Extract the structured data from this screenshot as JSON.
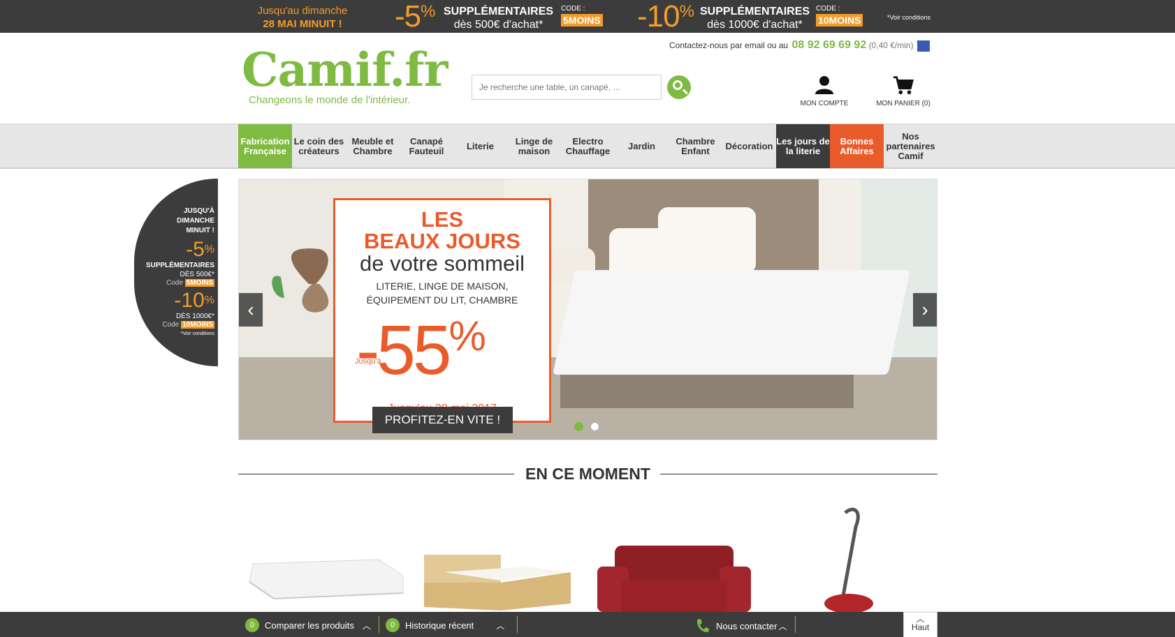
{
  "promo_top": {
    "when_line1": "Jusqu'au dimanche",
    "when_line2": "28 MAI MINUIT !",
    "offer1": {
      "pct": "-5",
      "sign": "%",
      "label1": "SUPPLÉMENTAIRES",
      "label2": "dès 500€ d'achat*",
      "code_label": "CODE :",
      "code": "5MOINS"
    },
    "offer2": {
      "pct": "-10",
      "sign": "%",
      "label1": "SUPPLÉMENTAIRES",
      "label2": "dès 1000€ d'achat*",
      "code_label": "CODE :",
      "code": "10MOINS"
    },
    "conditions": "*Voir conditions"
  },
  "header": {
    "logo_text": "Camif.fr",
    "tagline": "Changeons le monde de l'intérieur.",
    "contact_text": "Contactez-nous par email ou au",
    "phone": "08 92 69 69 92",
    "rate": "(0,40 €/min)",
    "search_placeholder": "Je recherche une table, un canapé, ...",
    "account_label": "MON COMPTE",
    "cart_label": "MON PANIER (0)"
  },
  "nav": {
    "items": [
      {
        "label": "Fabrication Française"
      },
      {
        "label": "Le coin des créateurs"
      },
      {
        "label": "Meuble et Chambre"
      },
      {
        "label": "Canapé Fauteuil"
      },
      {
        "label": "Literie"
      },
      {
        "label": "Linge de maison"
      },
      {
        "label": "Electro Chauffage"
      },
      {
        "label": "Jardin"
      },
      {
        "label": "Chambre Enfant"
      },
      {
        "label": "Décoration"
      },
      {
        "label": "Les jours de la literie"
      },
      {
        "label": "Bonnes Affaires"
      },
      {
        "label": "Nos partenaires Camif"
      }
    ]
  },
  "side_promo": {
    "line1": "JUSQU'À",
    "line2": "DIMANCHE",
    "line3": "MINUIT !",
    "pct1": "-5",
    "sign": "%",
    "supp": "SUPPLÉMENTAIRES",
    "from1": "DÈS 500€*",
    "code_label": "Code",
    "code1": "5MOINS",
    "pct2": "-10",
    "from2": "DÈS 1000€*",
    "code2": "10MOINS",
    "conditions": "*Voir conditions"
  },
  "slider": {
    "title1": "LES",
    "title2": "BEAUX JOURS",
    "title3": "de votre sommeil",
    "subtitle1": "LITERIE, LINGE DE MAISON,",
    "subtitle2": "ÉQUIPEMENT DU LIT, CHAMBRE",
    "jusqua": "Jusqu'à",
    "discount": "-55",
    "sign": "%",
    "date": "Jusqu'au 28 mai 2017",
    "cta": "PROFITEZ-EN VITE !",
    "prev": "‹",
    "next": "›"
  },
  "section": {
    "title": "EN CE MOMENT"
  },
  "bottom_bar": {
    "compare_count": "0",
    "compare_label": "Comparer les produits",
    "history_count": "0",
    "history_label": "Historique récent",
    "contact_label": "Nous contacter",
    "top_label": "Haut"
  },
  "colors": {
    "green": "#7fba42",
    "orange": "#ea5b2c",
    "promo_orange": "#f39c2b",
    "dark": "#3c3c3c"
  }
}
